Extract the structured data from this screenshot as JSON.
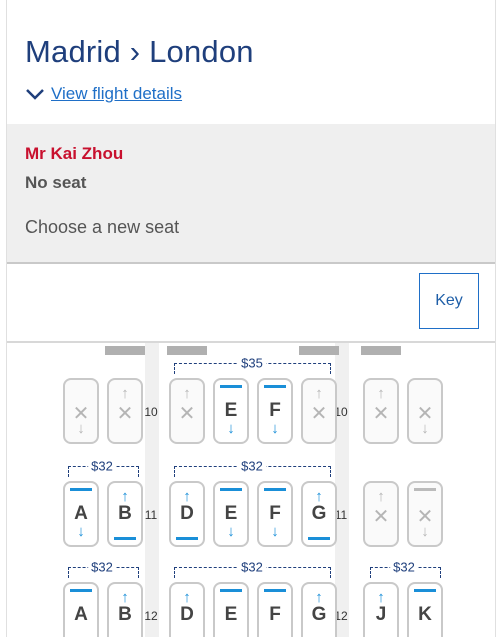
{
  "header": {
    "route_title": "Madrid › London",
    "view_details_link": "View flight details"
  },
  "passenger": {
    "name": "Mr Kai Zhou",
    "seat_status": "No seat",
    "prompt": "Choose a new seat"
  },
  "key_button": "Key",
  "seatmap": {
    "prices": [
      "$35",
      "$32",
      "$32",
      "$32",
      "$32",
      "$32"
    ],
    "rows": [
      {
        "number": "10",
        "seats": [
          {
            "letter": "",
            "status": "unavailable",
            "top": "none",
            "bottom": "down"
          },
          {
            "letter": "",
            "status": "unavailable",
            "top": "up",
            "bottom": "none"
          },
          {
            "letter": "",
            "status": "unavailable",
            "top": "up",
            "bottom": "none"
          },
          {
            "letter": "E",
            "status": "available",
            "top": "bar",
            "bottom": "down"
          },
          {
            "letter": "F",
            "status": "available",
            "top": "bar",
            "bottom": "down"
          },
          {
            "letter": "",
            "status": "unavailable",
            "top": "up",
            "bottom": "none"
          },
          {
            "letter": "",
            "status": "unavailable",
            "top": "up",
            "bottom": "none"
          },
          {
            "letter": "",
            "status": "unavailable",
            "top": "none",
            "bottom": "down"
          }
        ]
      },
      {
        "number": "11",
        "seats": [
          {
            "letter": "A",
            "status": "available",
            "top": "bar",
            "bottom": "down"
          },
          {
            "letter": "B",
            "status": "available",
            "top": "up",
            "bottom": "bar"
          },
          {
            "letter": "D",
            "status": "available",
            "top": "up",
            "bottom": "bar"
          },
          {
            "letter": "E",
            "status": "available",
            "top": "bar",
            "bottom": "down"
          },
          {
            "letter": "F",
            "status": "available",
            "top": "bar",
            "bottom": "down"
          },
          {
            "letter": "G",
            "status": "available",
            "top": "up",
            "bottom": "bar"
          },
          {
            "letter": "",
            "status": "unavailable",
            "top": "up",
            "bottom": "none"
          },
          {
            "letter": "",
            "status": "unavailable",
            "top": "bar",
            "bottom": "down"
          }
        ]
      },
      {
        "number": "12",
        "seats": [
          {
            "letter": "A",
            "status": "available",
            "top": "bar",
            "bottom": "none"
          },
          {
            "letter": "B",
            "status": "available",
            "top": "up",
            "bottom": "none"
          },
          {
            "letter": "D",
            "status": "available",
            "top": "up",
            "bottom": "none"
          },
          {
            "letter": "E",
            "status": "available",
            "top": "bar",
            "bottom": "none"
          },
          {
            "letter": "F",
            "status": "available",
            "top": "bar",
            "bottom": "none"
          },
          {
            "letter": "G",
            "status": "available",
            "top": "up",
            "bottom": "none"
          },
          {
            "letter": "J",
            "status": "available",
            "top": "up",
            "bottom": "none"
          },
          {
            "letter": "K",
            "status": "available",
            "top": "bar",
            "bottom": "none"
          }
        ]
      }
    ]
  },
  "colors": {
    "title": "#1f3f7c",
    "link": "#1f6fc7",
    "passenger_name": "#c8102e",
    "available_accent": "#1a8fd8",
    "unavailable": "#b5b5b5"
  }
}
